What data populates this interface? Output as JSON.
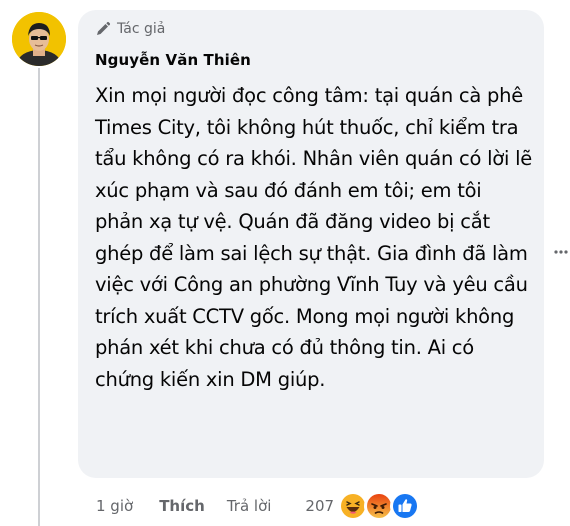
{
  "comment": {
    "author_badge_label": "Tác giả",
    "author_name": "Nguyễn Văn Thiên",
    "text": "Xin mọi người đọc công tâm: tại quán cà phê Times City, tôi không hút thuốc, chỉ kiểm tra tẩu không có ra khói. Nhân viên quán có lời lẽ xúc phạm và sau đó đánh em tôi; em tôi phản xạ tự vệ. Quán đã đăng video bị cắt ghép để làm sai lệch sự thật. Gia đình đã làm việc với Công an phường Vĩnh Tuy và yêu cầu trích xuất CCTV gốc. Mong mọi người không phán xét khi chưa có đủ thông tin. Ai có chứng kiến xin DM giúp."
  },
  "actions": {
    "time": "1 giờ",
    "like_label": "Thích",
    "reply_label": "Trả lời",
    "reaction_count": "207"
  },
  "icons": {
    "badge": "pencil-icon",
    "more": "more-options-icon",
    "reactions": [
      "haha-reaction-icon",
      "angry-reaction-icon",
      "like-reaction-icon"
    ]
  },
  "colors": {
    "bubble": "#f0f2f5",
    "secondary_text": "#65676b",
    "like_blue": "#1877f2",
    "angry_red": "#e9710f",
    "haha_yellow": "#f7b125"
  }
}
